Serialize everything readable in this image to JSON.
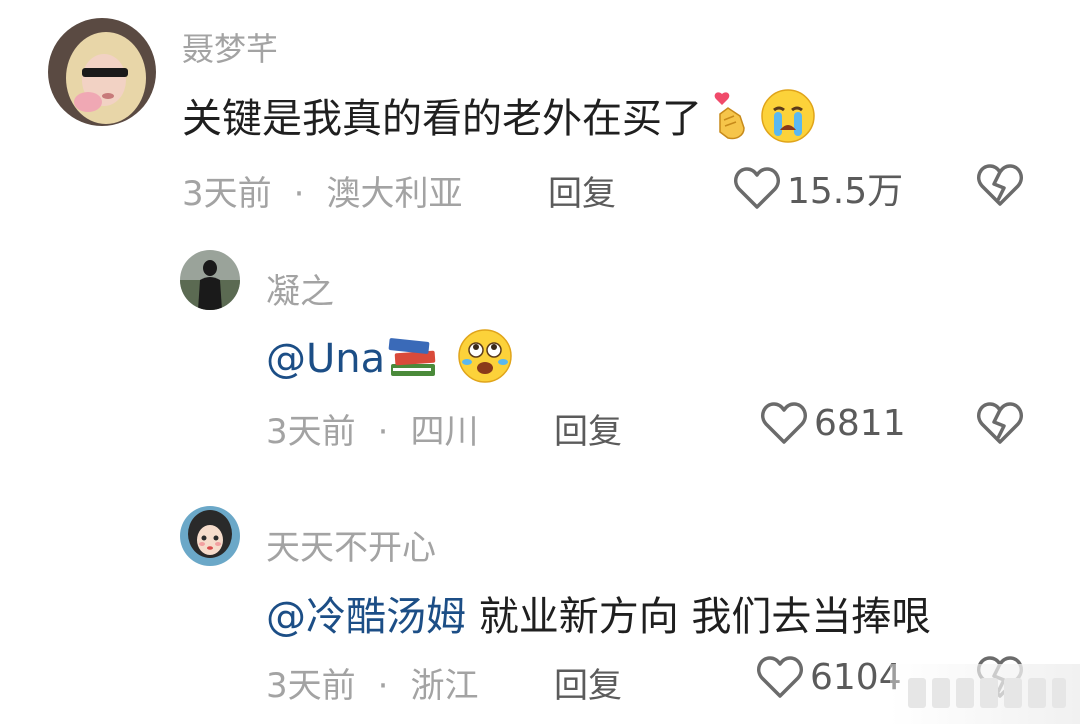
{
  "comments": [
    {
      "username": "聂梦芊",
      "text": "关键是我真的看的老外在买了",
      "time": "3天前",
      "location": "澳大利亚",
      "reply_label": "回复",
      "likes": "15.5万"
    },
    {
      "username": "凝之",
      "mention": "@Una",
      "text": "",
      "time": "3天前",
      "location": "四川",
      "reply_label": "回复",
      "likes": "6811"
    },
    {
      "username": "天天不开心",
      "mention": "@冷酷汤姆",
      "text": " 就业新方向 我们去当捧哏",
      "time": "3天前",
      "location": "浙江",
      "reply_label": "回复",
      "likes": "6104"
    }
  ],
  "icons": {
    "like": "heart-outline-icon",
    "dislike": "broken-heart-icon"
  },
  "colors": {
    "mention": "#1c4e86",
    "muted": "#a3a3a3",
    "text": "#1f1f1f"
  }
}
